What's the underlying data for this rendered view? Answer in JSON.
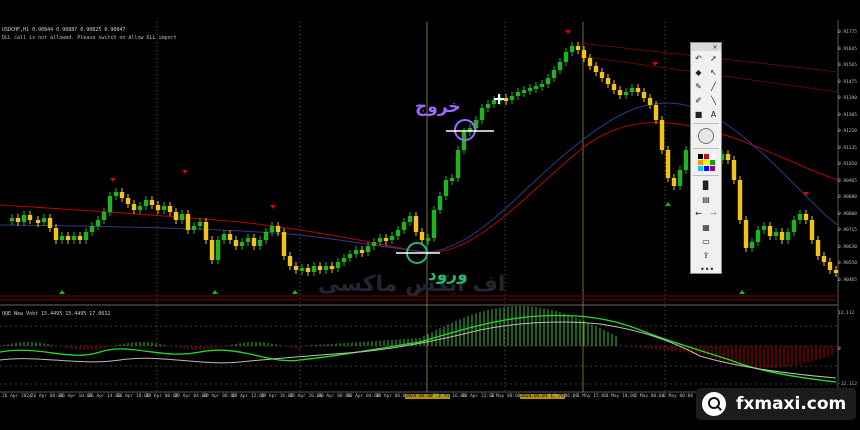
{
  "header": {
    "line1": "USDCHF,H1  0.90844 0.90887 0.90825 0.90847",
    "line2": "DLL call is not allowed. Please switch on   Allow DLL import"
  },
  "indicator": {
    "label": "QQE New Vokt 15.4495 15.4495 17.0612"
  },
  "annotations": {
    "exit": "خروج",
    "entry": "ورود"
  },
  "watermark": "اف ایکس ماکسی",
  "brand": {
    "name": "fxmaxi.com",
    "icon": "magnifier-icon"
  },
  "price_axis": [
    "0.91775",
    "0.91645",
    "0.91565",
    "0.91475",
    "0.91390",
    "0.91305",
    "0.91220",
    "0.91135",
    "0.91050",
    "0.90965",
    "0.90880",
    "0.90800",
    "0.90715",
    "0.90630",
    "0.90550",
    "0.90465"
  ],
  "indicator_axis": [
    "12.112",
    "0",
    "-12.112"
  ],
  "time_axis": [
    {
      "label": "26 Apr 2024",
      "hl": false
    },
    {
      "label": "26 Apr 08:00",
      "hl": false
    },
    {
      "label": "26 Apr 10:00",
      "hl": false
    },
    {
      "label": "26 Apr 14:00",
      "hl": false
    },
    {
      "label": "26 Apr 18:00",
      "hl": false
    },
    {
      "label": "29 Apr 00:00",
      "hl": false
    },
    {
      "label": "29 Apr 04:00",
      "hl": false
    },
    {
      "label": "29 Apr 08:00",
      "hl": false
    },
    {
      "label": "29 Apr 12:00",
      "hl": false
    },
    {
      "label": "29 Apr 16:00",
      "hl": false
    },
    {
      "label": "29 Apr 20:00",
      "hl": false
    },
    {
      "label": "30 Apr 00:00",
      "hl": false
    },
    {
      "label": "30 Apr 04:00",
      "hl": false
    },
    {
      "label": "30 Apr 06:00",
      "hl": false
    },
    {
      "label": "2024.04.30 12:00",
      "hl": true
    },
    {
      "label": "30 Apr 16:00",
      "hl": false
    },
    {
      "label": "30 Apr 22:00",
      "hl": false
    },
    {
      "label": "1 May 00:00",
      "hl": false
    },
    {
      "label": "2024.05.01 12:00",
      "hl": true
    },
    {
      "label": "1 May 06:00",
      "hl": false
    },
    {
      "label": "1 May 15:00",
      "hl": false
    },
    {
      "label": "1 May 18:00",
      "hl": false
    },
    {
      "label": "2 May 00:00",
      "hl": false
    },
    {
      "label": "2 May 00:00",
      "hl": false
    }
  ],
  "toolbox": {
    "tools": [
      "undo-icon",
      "cursor-icon",
      "eraser-icon",
      "pen-icon",
      "marker-icon",
      "line-icon",
      "highlighter-icon",
      "text-icon",
      "circle-icon",
      "color-grid-icon",
      "save-icon",
      "copy-icon",
      "back-icon",
      "forward-icon",
      "layout-icon",
      "screen-icon",
      "share-icon",
      "more-icon"
    ]
  },
  "colors": {
    "bull": "#1fb31f",
    "bear": "#f0c418",
    "ma_red": "#c00000",
    "ma_blue": "#2b3c8c",
    "exit_circle": "#9b6bff",
    "entry_circle": "#26b869"
  }
}
